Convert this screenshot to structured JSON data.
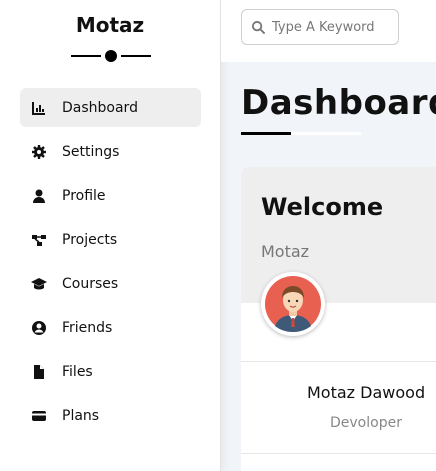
{
  "sidebar": {
    "brand": "Motaz",
    "items": [
      {
        "label": "Dashboard",
        "icon": "chart-icon",
        "active": true
      },
      {
        "label": "Settings",
        "icon": "gear-icon"
      },
      {
        "label": "Profile",
        "icon": "user-icon"
      },
      {
        "label": "Projects",
        "icon": "diagram-icon"
      },
      {
        "label": "Courses",
        "icon": "graduation-cap-icon"
      },
      {
        "label": "Friends",
        "icon": "user-circle-icon"
      },
      {
        "label": "Files",
        "icon": "file-icon"
      },
      {
        "label": "Plans",
        "icon": "credit-card-icon"
      }
    ]
  },
  "header": {
    "search_placeholder": "Type A Keyword"
  },
  "main": {
    "title": "Dashboard",
    "welcome_card": {
      "heading": "Welcome",
      "username": "Motaz",
      "full_name": "Motaz Dawood",
      "job": "Devoloper"
    }
  },
  "colors": {
    "active_bg": "#eeeeee",
    "page_bg": "#f1f5f9",
    "muted_text": "#777777"
  }
}
